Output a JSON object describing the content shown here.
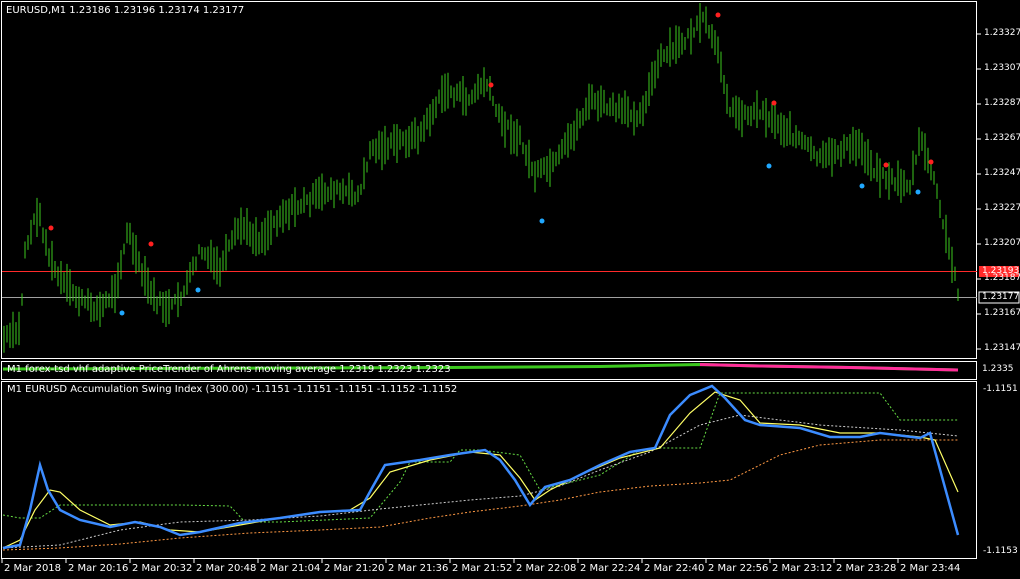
{
  "chart_title": "EURUSD,M1  1.23186 1.23196 1.23174 1.23177",
  "indicator1_title": "M1 forex-tsd vhf adaptive PriceTrender of Ahrens moving average 1.2319 1.2323 1.2323",
  "indicator1_value": "1.2335",
  "indicator2_title": "M1 EURUSD Accumulation Swing Index (300.00) -1.1151 -1.1151 -1.1151 -1.1152 -1.1152",
  "indicator2_top": "-1.1151",
  "indicator2_bottom": "-1.1153",
  "colors": {
    "bars": "#3cc81e",
    "axis": "#ffffff",
    "red_line": "#ff2a2a",
    "grey_line": "#a0a0a0",
    "asi": "#3c8cff",
    "signal": "#ffff66",
    "dot_red": "#ff2020",
    "dot_blue": "#20a8ff"
  },
  "price_axis": [
    "1.23327",
    "1.23307",
    "1.23287",
    "1.23267",
    "1.23247",
    "1.23227",
    "1.23207",
    "1.23187",
    "1.23167",
    "1.23147"
  ],
  "bid_label": "1.23193",
  "last_label": "1.23177",
  "time_axis": [
    "2 Mar 2018",
    "2 Mar 20:16",
    "2 Mar 20:32",
    "2 Mar 20:48",
    "2 Mar 21:04",
    "2 Mar 21:20",
    "2 Mar 21:36",
    "2 Mar 21:52",
    "2 Mar 22:08",
    "2 Mar 22:24",
    "2 Mar 22:40",
    "2 Mar 22:56",
    "2 Mar 23:12",
    "2 Mar 23:28",
    "2 Mar 23:44"
  ]
}
